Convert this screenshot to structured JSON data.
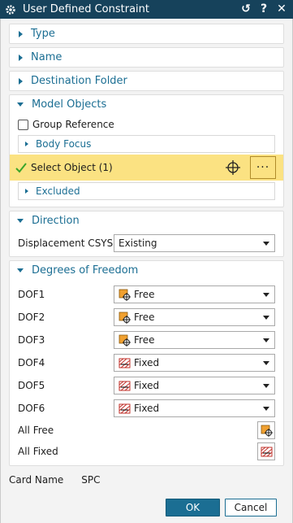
{
  "window": {
    "title": "User Defined Constraint"
  },
  "titlebar_icons": [
    "reset-icon",
    "help-icon",
    "close-icon"
  ],
  "titlebar_glyphs": {
    "reset": "↺",
    "help": "?",
    "close": "✕"
  },
  "sections": {
    "type": {
      "label": "Type",
      "expanded": false
    },
    "name": {
      "label": "Name",
      "expanded": false
    },
    "destination_folder": {
      "label": "Destination Folder",
      "expanded": false
    },
    "model_objects": {
      "label": "Model Objects",
      "expanded": true,
      "group_reference_label": "Group Reference",
      "group_reference_checked": false,
      "body_focus_label": "Body Focus",
      "select_object_label": "Select Object (1)",
      "more_label": "···",
      "excluded_label": "Excluded"
    },
    "direction": {
      "label": "Direction",
      "expanded": true,
      "displacement_csys_label": "Displacement CSYS",
      "displacement_csys_value": "Existing"
    },
    "degrees_of_freedom": {
      "label": "Degrees of Freedom",
      "expanded": true,
      "dofs": [
        {
          "label": "DOF1",
          "value": "Free",
          "icon": "free-icon"
        },
        {
          "label": "DOF2",
          "value": "Free",
          "icon": "free-icon"
        },
        {
          "label": "DOF3",
          "value": "Free",
          "icon": "free-icon"
        },
        {
          "label": "DOF4",
          "value": "Fixed",
          "icon": "fixed-icon"
        },
        {
          "label": "DOF5",
          "value": "Fixed",
          "icon": "fixed-icon"
        },
        {
          "label": "DOF6",
          "value": "Fixed",
          "icon": "fixed-icon"
        }
      ],
      "all_free_label": "All Free",
      "all_fixed_label": "All Fixed"
    }
  },
  "card_name": {
    "label": "Card Name",
    "value": "SPC"
  },
  "buttons": {
    "ok": "OK",
    "cancel": "Cancel"
  },
  "colors": {
    "titlebar": "#16425b",
    "accent": "#1b6e93",
    "selection_highlight": "#fbe282",
    "free_icon": "#f0a030",
    "fixed_icon": "#c0302a"
  }
}
